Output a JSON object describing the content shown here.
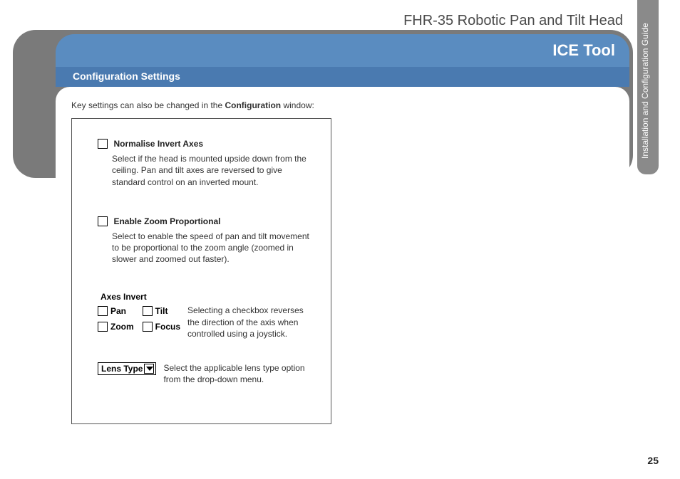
{
  "header": {
    "product_title": "FHR-35 Robotic Pan and Tilt Head",
    "side_tab": "Installation and Configuration Guide",
    "tool_title": "ICE Tool",
    "section_title": "Configuration Settings"
  },
  "content": {
    "intro_prefix": "Key settings can also be changed in the ",
    "intro_bold": "Configuration",
    "intro_suffix": " window:",
    "settings": {
      "normalise": {
        "label": "Normalise Invert Axes",
        "desc": "Select if the head is mounted upside down from the ceiling. Pan and tilt axes are reversed to give standard control on an inverted mount."
      },
      "zoom_prop": {
        "label": "Enable Zoom Proportional",
        "desc": "Select to enable the speed of pan and tilt movement to be proportional to the zoom angle (zoomed in slower and zoomed out faster)."
      },
      "axes_invert": {
        "title": "Axes Invert",
        "pan": "Pan",
        "tilt": "Tilt",
        "zoom": "Zoom",
        "focus": "Focus",
        "desc": "Selecting a checkbox reverses the direction of the axis when controlled using a joystick."
      },
      "lens": {
        "label": "Lens Type",
        "desc": "Select the applicable lens type option from the drop-down menu."
      }
    }
  },
  "page_number": "25"
}
